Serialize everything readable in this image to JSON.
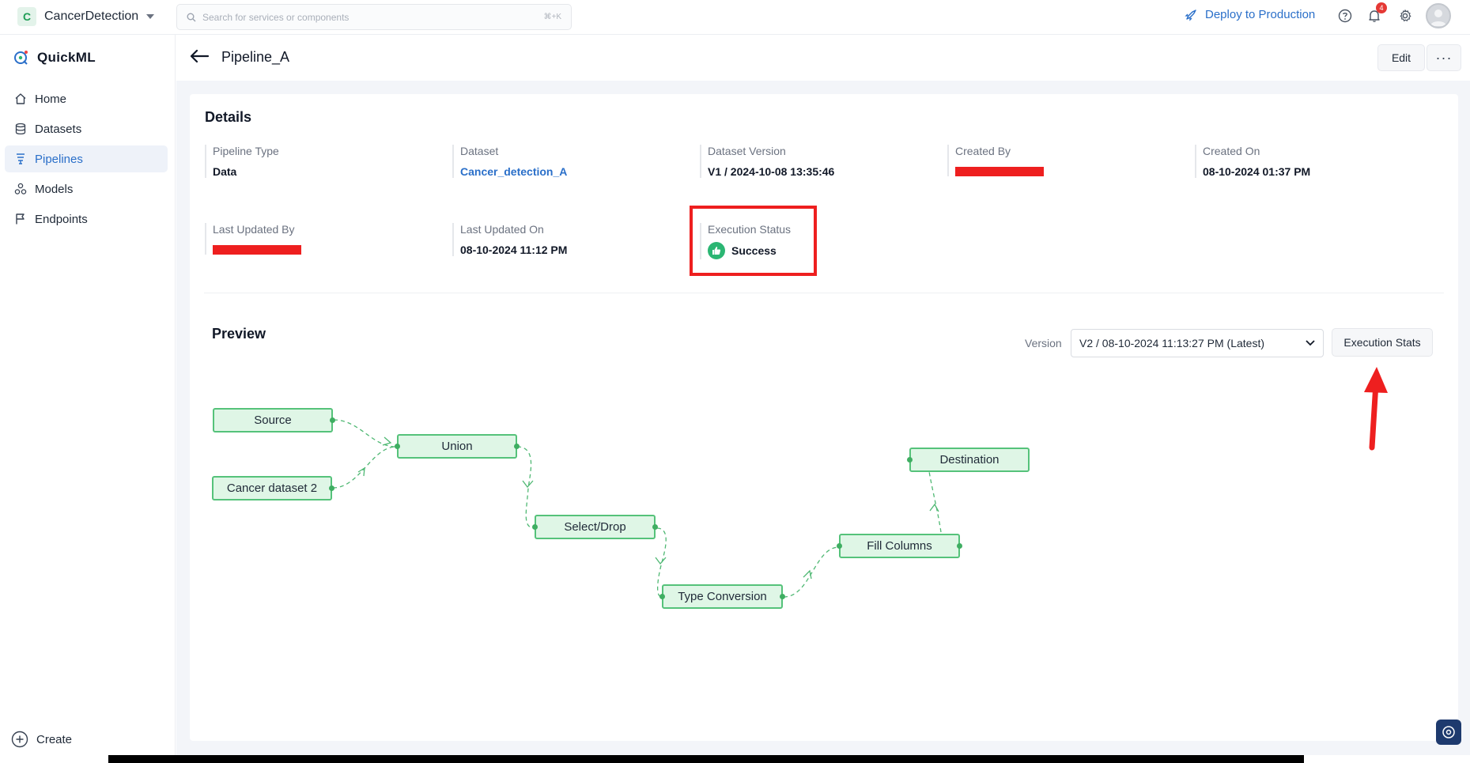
{
  "topbar": {
    "project_initial": "C",
    "project_name": "CancerDetection",
    "search_placeholder": "Search for services or components",
    "search_shortcut": "⌘+K",
    "deploy_label": "Deploy to Production",
    "notification_count": "4"
  },
  "sidebar": {
    "brand": "QuickML",
    "items": [
      {
        "label": "Home",
        "icon": "home-icon"
      },
      {
        "label": "Datasets",
        "icon": "database-icon"
      },
      {
        "label": "Pipelines",
        "icon": "pipeline-icon"
      },
      {
        "label": "Models",
        "icon": "models-icon"
      },
      {
        "label": "Endpoints",
        "icon": "endpoint-icon"
      }
    ],
    "active_item": "Pipelines",
    "create_label": "Create"
  },
  "header": {
    "title": "Pipeline_A",
    "edit_label": "Edit",
    "more_label": "···"
  },
  "details": {
    "title": "Details",
    "pipeline_type_label": "Pipeline Type",
    "pipeline_type_value": "Data",
    "dataset_label": "Dataset",
    "dataset_value": "Cancer_detection_A",
    "dataset_version_label": "Dataset Version",
    "dataset_version_value": "V1 / 2024-10-08 13:35:46",
    "created_by_label": "Created By",
    "created_on_label": "Created On",
    "created_on_value": "08-10-2024 01:37 PM",
    "last_updated_by_label": "Last Updated By",
    "last_updated_on_label": "Last Updated On",
    "last_updated_on_value": "08-10-2024 11:12 PM",
    "execution_status_label": "Execution Status",
    "execution_status_value": "Success"
  },
  "preview": {
    "title": "Preview",
    "version_label": "Version",
    "version_value": "V2 / 08-10-2024 11:13:27 PM (Latest)",
    "exec_stats_label": "Execution Stats",
    "nodes": {
      "source": "Source",
      "cancer2": "Cancer dataset 2",
      "union": "Union",
      "select": "Select/Drop",
      "typeconv": "Type Conversion",
      "fill": "Fill Columns",
      "dest": "Destination"
    }
  },
  "colors": {
    "accent": "#2a6fc9",
    "node_fill": "#dff6e6",
    "node_border": "#55c27a",
    "annotation_red": "#ee1f1f",
    "success": "#2bb673"
  }
}
